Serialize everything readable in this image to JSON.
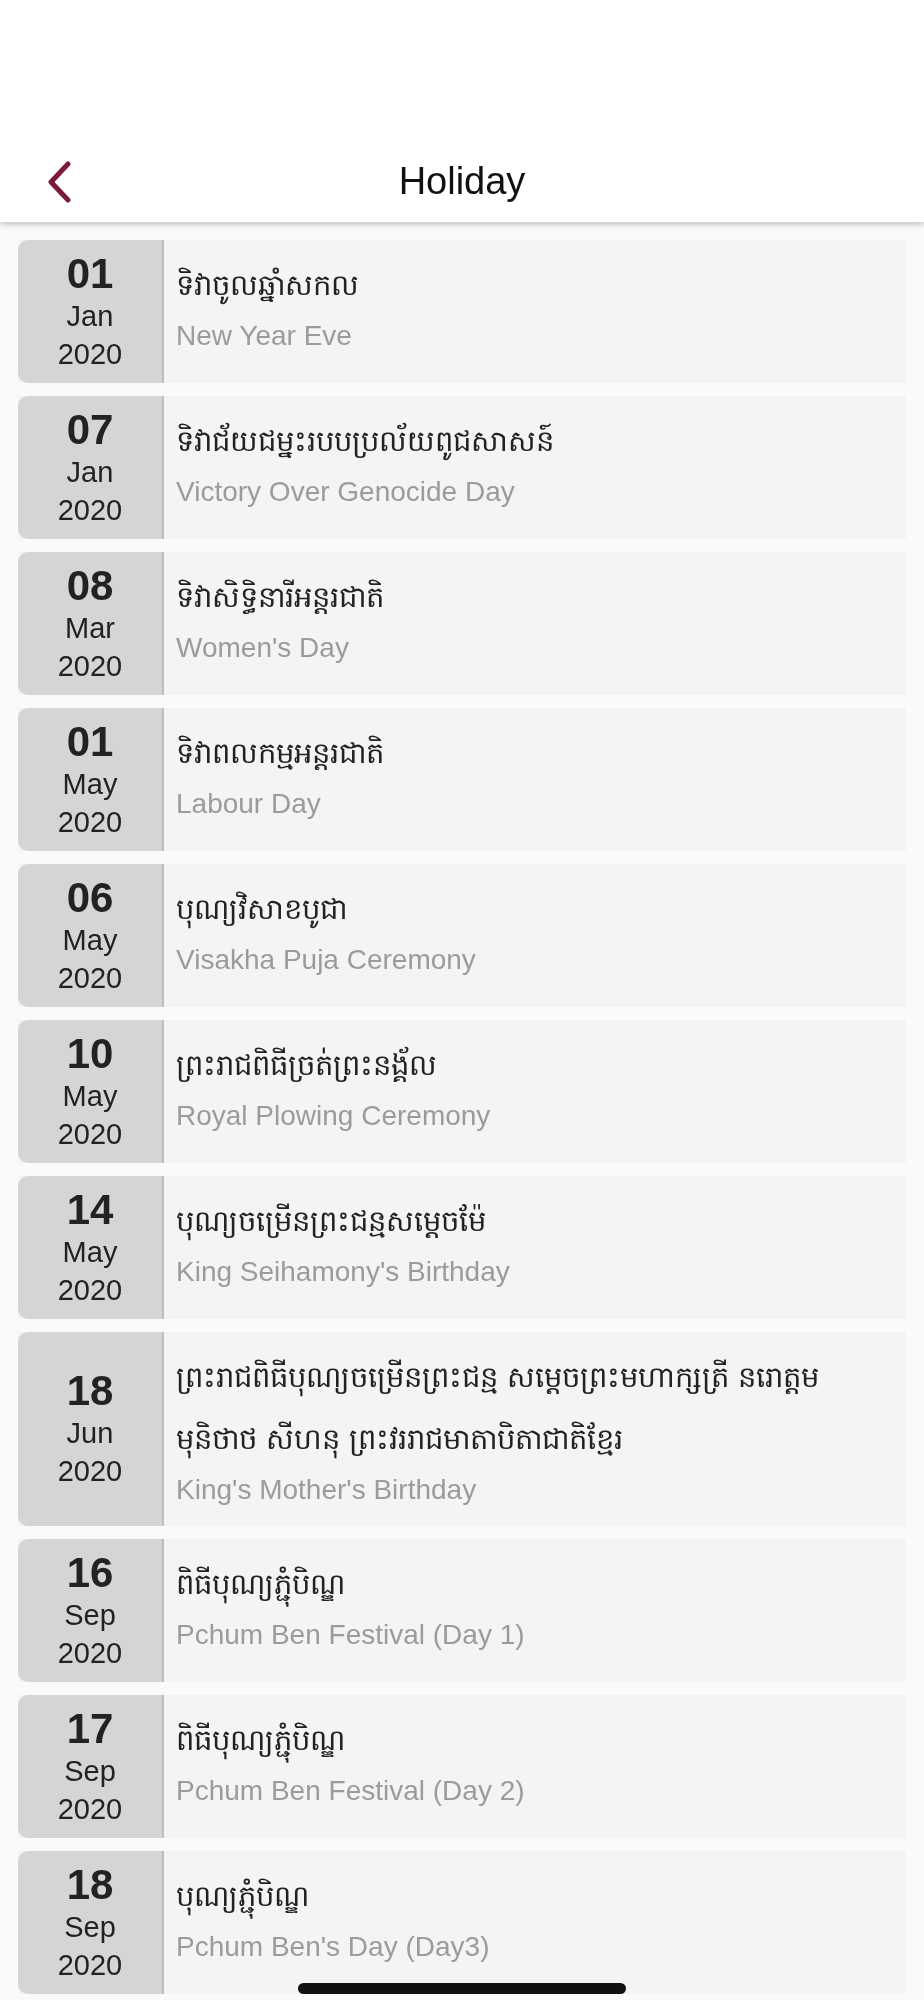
{
  "header": {
    "title": "Holiday"
  },
  "holidays": [
    {
      "day": "01",
      "month": "Jan",
      "year": "2020",
      "name_km": "ទិវាចូលឆ្នាំសកល",
      "name_en": "New Year Eve"
    },
    {
      "day": "07",
      "month": "Jan",
      "year": "2020",
      "name_km": "ទិវាជ័យជម្នះរបបប្រល័យពូជសាសន៍",
      "name_en": "Victory Over Genocide Day"
    },
    {
      "day": "08",
      "month": "Mar",
      "year": "2020",
      "name_km": "ទិវាសិទ្ធិនារីអន្តរជាតិ",
      "name_en": "Women's Day"
    },
    {
      "day": "01",
      "month": "May",
      "year": "2020",
      "name_km": "ទិវាពលកម្មអន្តរជាតិ",
      "name_en": "Labour Day"
    },
    {
      "day": "06",
      "month": "May",
      "year": "2020",
      "name_km": "បុណ្យវិសាខបូជា",
      "name_en": "Visakha Puja Ceremony"
    },
    {
      "day": "10",
      "month": "May",
      "year": "2020",
      "name_km": "ព្រះរាជពិធីច្រត់ព្រះនង្គ័ល",
      "name_en": "Royal Plowing Ceremony"
    },
    {
      "day": "14",
      "month": "May",
      "year": "2020",
      "name_km": "បុណ្យចម្រើនព្រះជន្មសម្តេចម៉ែ",
      "name_en": "King Seihamony's Birthday"
    },
    {
      "day": "18",
      "month": "Jun",
      "year": "2020",
      "name_km": "ព្រះរាជពិធីបុណ្យចម្រើនព្រះជន្ម សម្តេចព្រះមហាក្សត្រី នរោត្តម មុនិថាថ សីហនុ ព្រះវររាជមាតាបិតាជាតិខ្មែរ",
      "name_en": "King's Mother's Birthday"
    },
    {
      "day": "16",
      "month": "Sep",
      "year": "2020",
      "name_km": "ពិធីបុណ្យភ្ជុំបិណ្ឌ",
      "name_en": "Pchum Ben Festival (Day 1)"
    },
    {
      "day": "17",
      "month": "Sep",
      "year": "2020",
      "name_km": "ពិធីបុណ្យភ្ជុំបិណ្ឌ",
      "name_en": "Pchum Ben Festival (Day 2)"
    },
    {
      "day": "18",
      "month": "Sep",
      "year": "2020",
      "name_km": "បុណ្យភ្ជុំបិណ្ឌ",
      "name_en": "Pchum Ben's Day (Day3)"
    }
  ]
}
